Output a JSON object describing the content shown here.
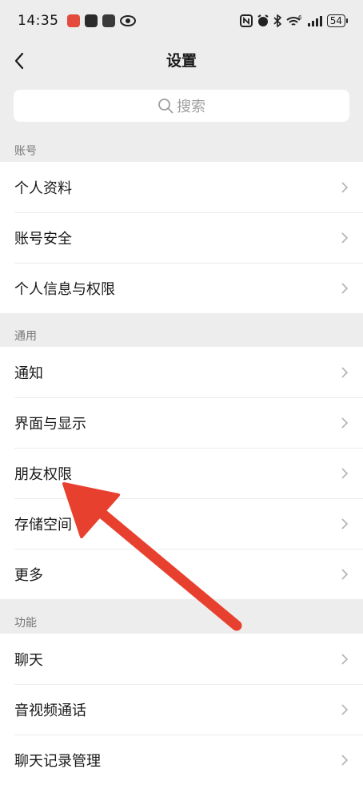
{
  "status_bar": {
    "time": "14:35",
    "battery": "54",
    "notif_icons": [
      "red-app-icon",
      "dark-app-icon",
      "dark-app-icon-2",
      "eye-icon"
    ],
    "sys_icons": [
      "nfc-icon",
      "alarm-icon",
      "bluetooth-icon",
      "wifi-6-icon",
      "signal-icon",
      "battery-icon"
    ]
  },
  "nav": {
    "title": "设置"
  },
  "search": {
    "placeholder": "搜索"
  },
  "sections": [
    {
      "label": "账号",
      "items": [
        "个人资料",
        "账号安全",
        "个人信息与权限"
      ]
    },
    {
      "label": "通用",
      "items": [
        "通知",
        "界面与显示",
        "朋友权限",
        "存储空间",
        "更多"
      ]
    },
    {
      "label": "功能",
      "items": [
        "聊天",
        "音视频通话",
        "聊天记录管理"
      ]
    }
  ],
  "annotation": {
    "color": "#e8402e",
    "target": "朋友权限"
  }
}
